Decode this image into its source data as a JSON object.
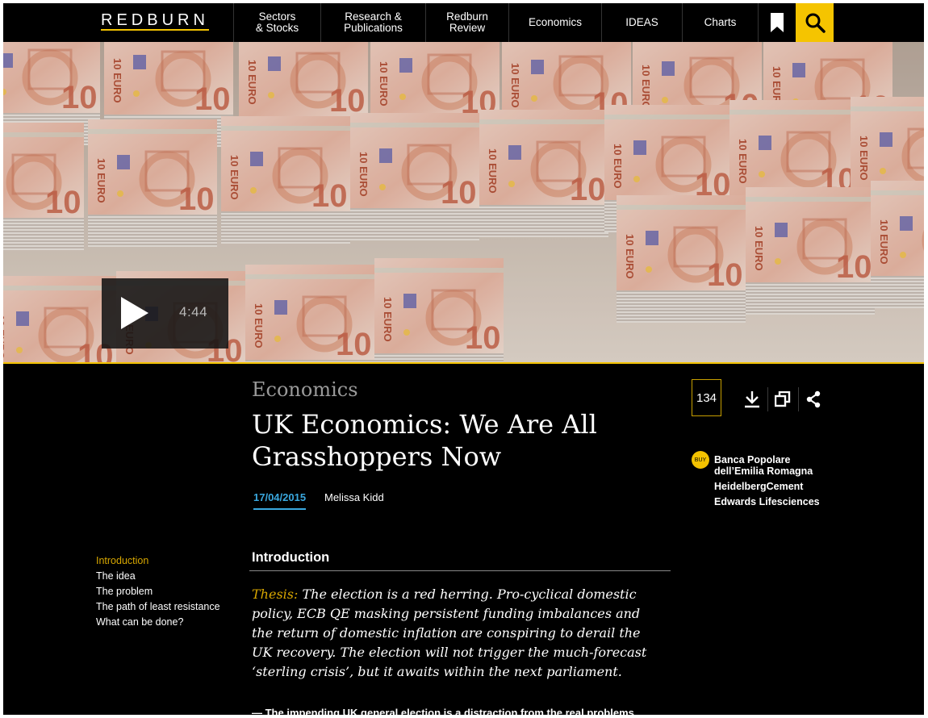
{
  "nav": {
    "logo": "REDBURN",
    "items": [
      {
        "label": "Sectors\n& Stocks"
      },
      {
        "label": "Research &\nPublications"
      },
      {
        "label": "Redburn\nReview"
      },
      {
        "label": "Economics"
      },
      {
        "label": "IDEAS"
      },
      {
        "label": "Charts"
      }
    ]
  },
  "video": {
    "duration": "4:44"
  },
  "article": {
    "category": "Economics",
    "title": "UK Economics: We Are All Grasshoppers Now",
    "date": "17/04/2015",
    "author": "Melissa Kidd",
    "count": "134"
  },
  "companies": {
    "badge": "BUY",
    "items": [
      {
        "name": "Banca Popolare\ndell’Emilia Romagna"
      },
      {
        "name": "HeidelbergCement"
      },
      {
        "name": "Edwards Lifesciences"
      }
    ]
  },
  "toc": [
    {
      "label": "Introduction",
      "active": true
    },
    {
      "label": "The idea"
    },
    {
      "label": "The problem"
    },
    {
      "label": "The path of least resistance"
    },
    {
      "label": "What can be done?"
    }
  ],
  "body": {
    "section_heading": "Introduction",
    "thesis_lead": "Thesis:",
    "thesis_text": " The election is a red herring. Pro-cyclical domestic policy, ECB QE masking persistent funding imbalances and the return of domestic inflation are conspiring to derail the UK recovery. The election will not trigger the much-forecast ‘sterling crisis’, but it awaits within the next parliament.",
    "bullet": "— The impending UK general election is a distraction from the real problems"
  },
  "colors": {
    "accent": "#f3c200",
    "date": "#3aa8df",
    "toc_active": "#d8a700"
  }
}
